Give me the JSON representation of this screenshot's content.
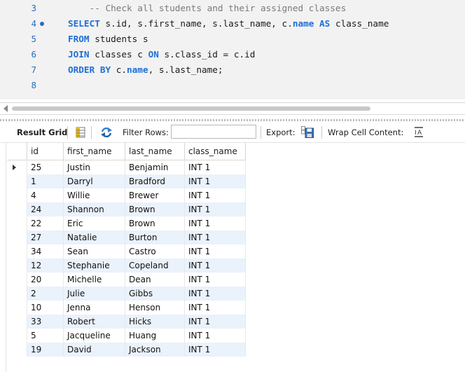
{
  "editor": {
    "lines": [
      {
        "num": "3",
        "parts": [
          {
            "t": "    -- Check all students and their assigned classes",
            "c": "cm"
          }
        ]
      },
      {
        "num": "4",
        "dot": true,
        "parts": [
          {
            "t": "SELECT",
            "c": "kw"
          },
          {
            "t": " s.id, s.first_name, s.last_name, c.",
            "c": ""
          },
          {
            "t": "name",
            "c": "kw"
          },
          {
            "t": " ",
            "c": ""
          },
          {
            "t": "AS",
            "c": "kw"
          },
          {
            "t": " class_name",
            "c": ""
          }
        ]
      },
      {
        "num": "5",
        "parts": [
          {
            "t": "FROM",
            "c": "kw"
          },
          {
            "t": " students s",
            "c": ""
          }
        ]
      },
      {
        "num": "6",
        "parts": [
          {
            "t": "JOIN",
            "c": "kw"
          },
          {
            "t": " classes c ",
            "c": ""
          },
          {
            "t": "ON",
            "c": "kw"
          },
          {
            "t": " s.class_id = c.id",
            "c": ""
          }
        ]
      },
      {
        "num": "7",
        "parts": [
          {
            "t": "ORDER BY",
            "c": "kw"
          },
          {
            "t": " c.",
            "c": ""
          },
          {
            "t": "name",
            "c": "kw"
          },
          {
            "t": ", s.last_name;",
            "c": ""
          }
        ]
      },
      {
        "num": "8",
        "parts": []
      }
    ]
  },
  "toolbar": {
    "result_grid_label": "Result Grid",
    "filter_rows_label": "Filter Rows:",
    "filter_value": "",
    "export_label": "Export:",
    "wrap_label": "Wrap Cell Content:"
  },
  "grid": {
    "columns": [
      "id",
      "first_name",
      "last_name",
      "class_name"
    ],
    "rows": [
      [
        "25",
        "Justin",
        "Benjamin",
        "INT 1"
      ],
      [
        "1",
        "Darryl",
        "Bradford",
        "INT 1"
      ],
      [
        "4",
        "Willie",
        "Brewer",
        "INT 1"
      ],
      [
        "24",
        "Shannon",
        "Brown",
        "INT 1"
      ],
      [
        "22",
        "Eric",
        "Brown",
        "INT 1"
      ],
      [
        "27",
        "Natalie",
        "Burton",
        "INT 1"
      ],
      [
        "34",
        "Sean",
        "Castro",
        "INT 1"
      ],
      [
        "12",
        "Stephanie",
        "Copeland",
        "INT 1"
      ],
      [
        "20",
        "Michelle",
        "Dean",
        "INT 1"
      ],
      [
        "2",
        "Julie",
        "Gibbs",
        "INT 1"
      ],
      [
        "10",
        "Jenna",
        "Henson",
        "INT 1"
      ],
      [
        "33",
        "Robert",
        "Hicks",
        "INT 1"
      ],
      [
        "5",
        "Jacqueline",
        "Huang",
        "INT 1"
      ],
      [
        "19",
        "David",
        "Jackson",
        "INT 1"
      ]
    ],
    "current_row": 0
  }
}
